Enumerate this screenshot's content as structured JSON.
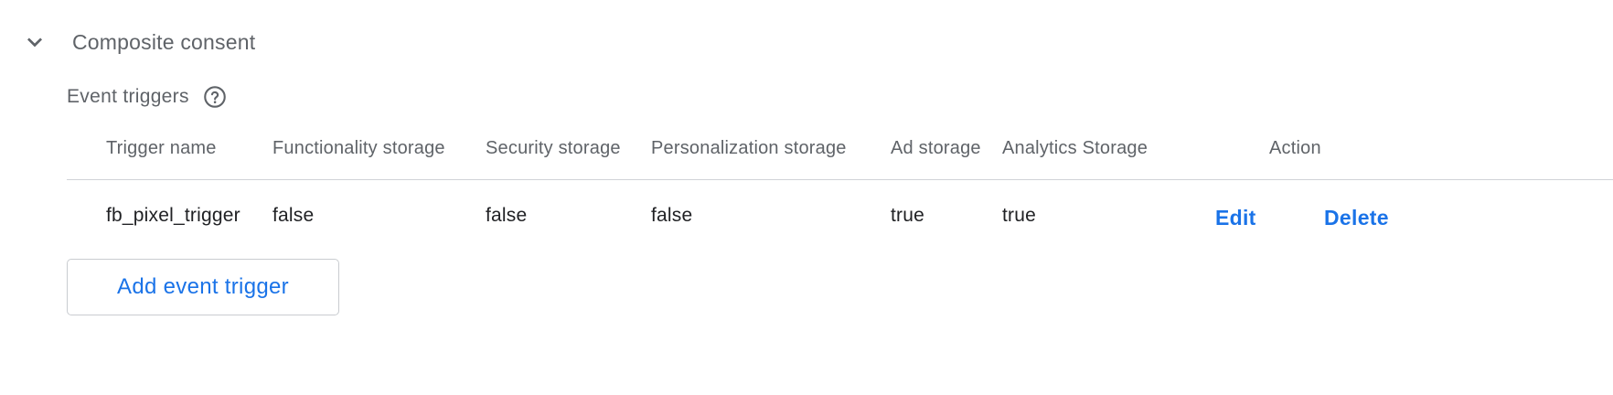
{
  "section": {
    "title": "Composite consent",
    "chevron_icon": "chevron-down-icon"
  },
  "subheader": {
    "label": "Event triggers",
    "help_icon": "help-circle-icon"
  },
  "table": {
    "headers": {
      "trigger_name": "Trigger name",
      "functionality_storage": "Functionality storage",
      "security_storage": "Security storage",
      "personalization_storage": "Personalization storage",
      "ad_storage": "Ad storage",
      "analytics_storage": "Analytics Storage",
      "action": "Action"
    },
    "rows": [
      {
        "trigger_name": "fb_pixel_trigger",
        "functionality_storage": "false",
        "security_storage": "false",
        "personalization_storage": "false",
        "ad_storage": "true",
        "analytics_storage": "true",
        "edit_label": "Edit",
        "delete_label": "Delete"
      }
    ]
  },
  "add_button": {
    "label": "Add event trigger"
  },
  "colors": {
    "accent": "#1a73e8",
    "muted_text": "#5f6368",
    "divider": "#d0d3d7"
  }
}
